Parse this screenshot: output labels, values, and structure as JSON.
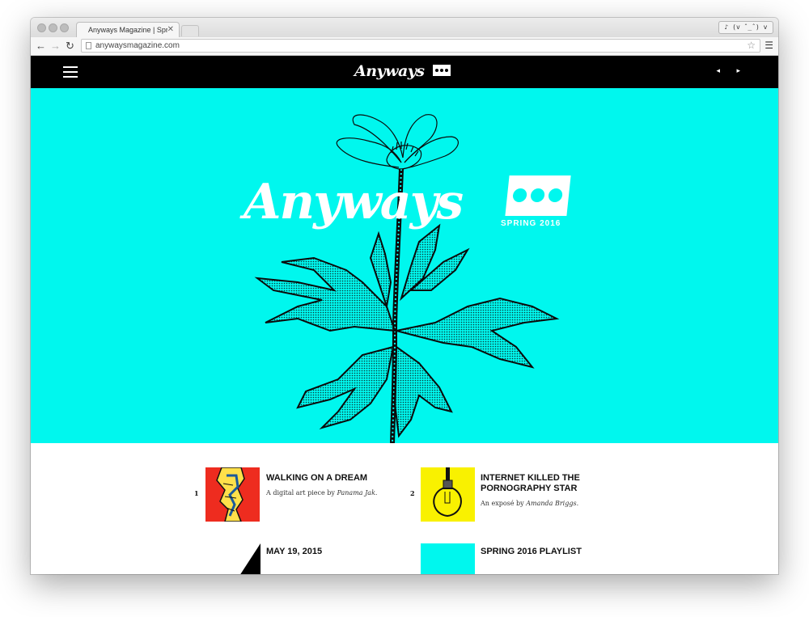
{
  "browser": {
    "tab_title": "Anyways Magazine | Spring",
    "tab_close": "✕",
    "profile_label": "♪ (v ˆ_ˆ) v",
    "back": "←",
    "forward": "→",
    "reload": "↻",
    "url": "anywaysmagazine.com",
    "star": "☆",
    "menu": "☰"
  },
  "site": {
    "logo_text": "Anyways",
    "nav_arrows": "◂ ▸",
    "hero": {
      "logo_text": "Anyways",
      "issue": "SPRING 2016",
      "background": "#00f7ee"
    }
  },
  "articles": [
    {
      "number": "1",
      "title": "WALKING ON A DREAM",
      "desc_prefix": "A digital art piece by",
      "author": "Panama Jak.",
      "thumb_color": "#ee2c1f"
    },
    {
      "number": "2",
      "title": "INTERNET KILLED THE PORNOGRAPHY STAR",
      "desc_prefix": "An exposé by",
      "author": "Amanda Briggs.",
      "thumb_color": "#f9f100"
    },
    {
      "number": "",
      "title": "MAY 19, 2015",
      "desc_prefix": "",
      "author": "",
      "thumb_color": "#000000"
    },
    {
      "number": "",
      "title": "SPRING 2016 PLAYLIST",
      "desc_prefix": "",
      "author": "",
      "thumb_color": "#00f7ee"
    }
  ]
}
